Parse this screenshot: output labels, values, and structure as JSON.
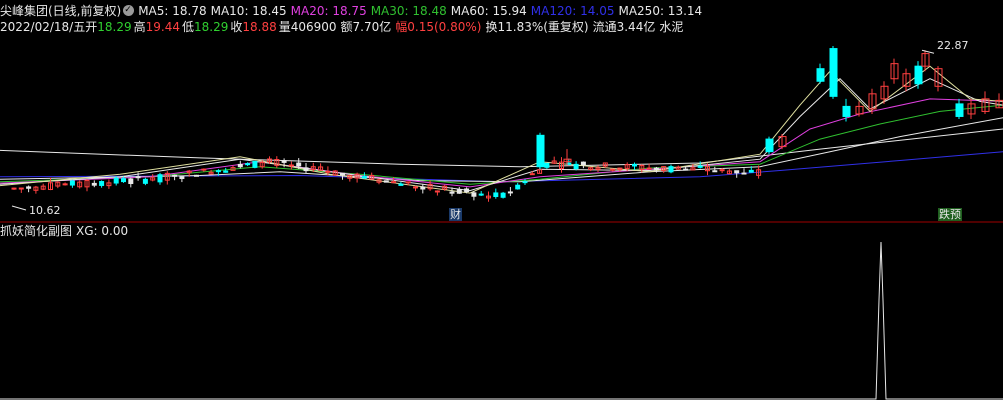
{
  "header": {
    "stock": "尖峰集团(日线,前复权)",
    "ma": [
      {
        "label": "MA5: 18.78",
        "color": "#e8e8e8"
      },
      {
        "label": "MA10: 18.45",
        "color": "#e8e8e8"
      },
      {
        "label": "MA20: 18.75",
        "color": "#e040e0"
      },
      {
        "label": "MA30: 18.48",
        "color": "#30c030"
      },
      {
        "label": "MA60: 15.94",
        "color": "#e8e8e8"
      },
      {
        "label": "MA120: 14.05",
        "color": "#3030e8"
      },
      {
        "label": "MA250: 13.14",
        "color": "#e8e8e8"
      }
    ]
  },
  "quote": {
    "date": "2022/02/18/五",
    "open_label": "开",
    "open": "18.29",
    "high_label": "高",
    "high": "19.44",
    "low_label": "低",
    "low": "18.29",
    "close_label": "收",
    "close": "18.88",
    "volume": "量406900",
    "amount": "额7.70亿",
    "change": "幅0.15(0.80%)",
    "turnover": "换11.83%(重复权)",
    "float": "流通3.44亿",
    "sector": "水泥"
  },
  "price_chart": {
    "high_marker": "22.87",
    "low_marker": "10.62",
    "event_tag_cai": "财",
    "event_tag_yuyu": "跌预",
    "colors": {
      "up": "#ff4040",
      "down": "#00ffff",
      "flat": "#e8e8e8",
      "bg": "#000000",
      "divider": "#a00000"
    }
  },
  "sub_chart": {
    "title": "抓妖简化副图",
    "xg": "XG: 0.00",
    "color": "#e8e8e8"
  }
}
